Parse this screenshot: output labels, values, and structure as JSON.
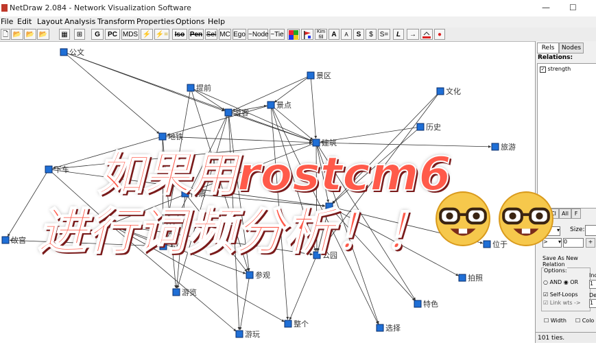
{
  "window": {
    "title": "NetDraw 2.084 - Network Visualization Software",
    "minimize": "—",
    "maximize": "☐"
  },
  "menu": [
    "File",
    "Edit",
    "Layout",
    "Analysis",
    "Transform",
    "Properties",
    "Options",
    "Help"
  ],
  "toolbar": [
    "G",
    "PC",
    "MDS",
    "⚡",
    "⚡=",
    "Iso",
    "Pen",
    "Sel",
    "MC",
    "Ego",
    "~Node",
    "~Tie",
    "A",
    "A",
    "S",
    "$",
    "S=",
    "L",
    "→",
    "●"
  ],
  "nodes": [
    {
      "id": "gongwen",
      "label": "公文"
    },
    {
      "id": "tiqian",
      "label": "提前"
    },
    {
      "id": "jingqu",
      "label": "景区"
    },
    {
      "id": "wenhua",
      "label": "文化"
    },
    {
      "id": "youke",
      "label": "游客"
    },
    {
      "id": "jingdian",
      "label": "景点"
    },
    {
      "id": "lishi",
      "label": "历史"
    },
    {
      "id": "dite",
      "label": "地铁"
    },
    {
      "id": "jianzhu",
      "label": "建筑"
    },
    {
      "id": "lvyou",
      "label": "旅游"
    },
    {
      "id": "xiache",
      "label": "下车"
    },
    {
      "id": "menpiao",
      "label": "门票"
    },
    {
      "id": "gugong",
      "label": "故宫"
    },
    {
      "id": "fangbian",
      "label": "方便"
    },
    {
      "id": "weiyu",
      "label": "位于"
    },
    {
      "id": "gongyuan",
      "label": "公园"
    },
    {
      "id": "canguan",
      "label": "参观"
    },
    {
      "id": "paizhao",
      "label": "拍照"
    },
    {
      "id": "youlan",
      "label": "游览"
    },
    {
      "id": "tese",
      "label": "特色"
    },
    {
      "id": "zhengge",
      "label": "整个"
    },
    {
      "id": "xuanze",
      "label": "选择"
    },
    {
      "id": "youwan",
      "label": "游玩"
    },
    {
      "id": "n1",
      "label": ""
    },
    {
      "id": "n2",
      "label": ""
    }
  ],
  "edges": [
    [
      "gongwen",
      "dite"
    ],
    [
      "gongwen",
      "youke"
    ],
    [
      "gongwen",
      "jianzhu"
    ],
    [
      "tiqian",
      "youke"
    ],
    [
      "tiqian",
      "jianzhu"
    ],
    [
      "tiqian",
      "fangbian"
    ],
    [
      "tiqian",
      "canguan"
    ],
    [
      "jingqu",
      "jianzhu"
    ],
    [
      "jingqu",
      "jingdian"
    ],
    [
      "jingqu",
      "youke"
    ],
    [
      "wenhua",
      "gongyuan"
    ],
    [
      "wenhua",
      "n1"
    ],
    [
      "youke",
      "jianzhu"
    ],
    [
      "youke",
      "jingdian"
    ],
    [
      "youke",
      "youlan"
    ],
    [
      "youke",
      "canguan"
    ],
    [
      "youke",
      "youwan"
    ],
    [
      "youke",
      "fangbian"
    ],
    [
      "jingdian",
      "jianzhu"
    ],
    [
      "jingdian",
      "dite"
    ],
    [
      "jingdian",
      "gongyuan"
    ],
    [
      "jingdian",
      "zhengge"
    ],
    [
      "jingdian",
      "xuanze"
    ],
    [
      "lishi",
      "jianzhu"
    ],
    [
      "lishi",
      "n1"
    ],
    [
      "dite",
      "jianzhu"
    ],
    [
      "dite",
      "xiache"
    ],
    [
      "dite",
      "fangbian"
    ],
    [
      "dite",
      "youlan"
    ],
    [
      "jianzhu",
      "lvyou"
    ],
    [
      "jianzhu",
      "gongyuan"
    ],
    [
      "jianzhu",
      "n1"
    ],
    [
      "jianzhu",
      "n2"
    ],
    [
      "xiache",
      "jianzhu"
    ],
    [
      "xiache",
      "n2"
    ],
    [
      "xiache",
      "n1"
    ],
    [
      "xiache",
      "gugong"
    ],
    [
      "menpiao",
      "n1"
    ],
    [
      "menpiao",
      "canguan"
    ],
    [
      "menpiao",
      "youlan"
    ],
    [
      "n2",
      "fangbian"
    ],
    [
      "n2",
      "canguan"
    ],
    [
      "n2",
      "youwan"
    ],
    [
      "n2",
      "zhengge"
    ],
    [
      "n2",
      "gongyuan"
    ],
    [
      "n1",
      "weiyu"
    ],
    [
      "n1",
      "paizhao"
    ],
    [
      "n1",
      "tese"
    ],
    [
      "n1",
      "gongyuan"
    ],
    [
      "fangbian",
      "gugong"
    ],
    [
      "gongyuan",
      "zhengge"
    ],
    [
      "canguan",
      "youwan"
    ],
    [
      "jianzhu",
      "xuanze"
    ],
    [
      "jianzhu",
      "tese"
    ]
  ],
  "panel": {
    "tabs": [
      "Rels",
      "Nodes"
    ],
    "relations_label": "Relations:",
    "relation_item": "strength",
    "buttons": [
      "Up",
      "Cl",
      "All",
      "F"
    ],
    "size_label": "Size:",
    "gt_value": ">",
    "zero_value": "0",
    "plus": "+",
    "save_button": "Save As New Relation",
    "options_label": "Options:",
    "and_label": "AND",
    "or_label": "OR",
    "in_label": "Inc",
    "in_value": "1",
    "self_loops": "Self-Loops",
    "link_wts": "Link wts ->",
    "de_label": "De",
    "de_value": "1",
    "width_label": "Width",
    "color_label": "Colo",
    "status": "101 ties."
  },
  "overlay": {
    "line1": "如果用rostcm6",
    "line2": "进行词频分析！！"
  }
}
